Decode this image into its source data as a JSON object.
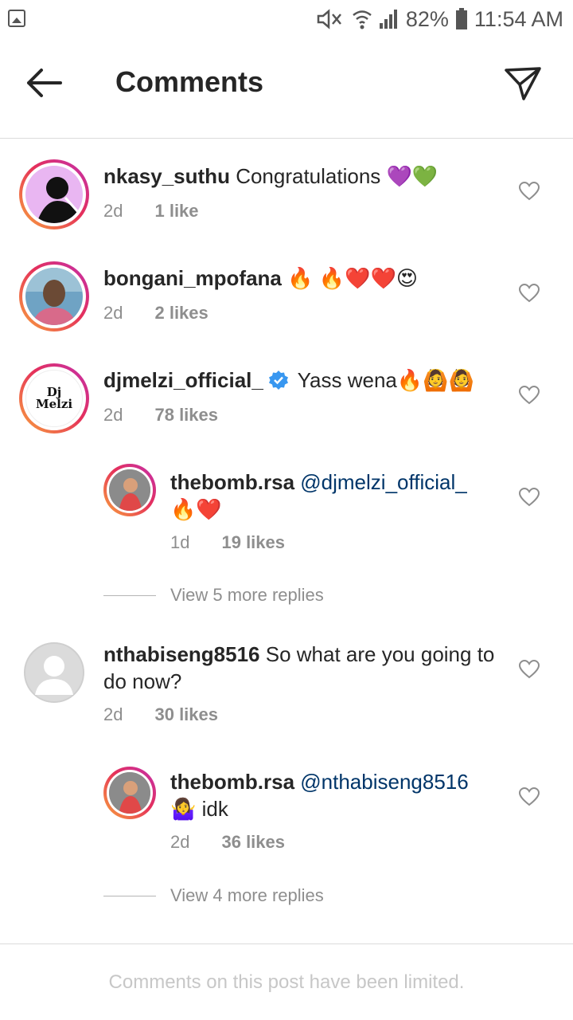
{
  "status_bar": {
    "battery": "82%",
    "time": "11:54 AM"
  },
  "header": {
    "title": "Comments"
  },
  "comments": [
    {
      "username": "nkasy_suthu",
      "text": "Congratulations 💜💚",
      "time": "2d",
      "likes": "1 like"
    },
    {
      "username": "bongani_mpofana",
      "text": "🔥 🔥❤️❤️😍",
      "time": "2d",
      "likes": "2 likes"
    },
    {
      "username": "djmelzi_official_",
      "text": "Yass wena🔥🙆🙆",
      "time": "2d",
      "likes": "78 likes",
      "avatar_text": "Dj Melzi",
      "reply": {
        "username": "thebomb.rsa",
        "mention": "@djmelzi_official_",
        "text": "🔥❤️",
        "time": "1d",
        "likes": "19 likes"
      },
      "view_more": "View 5 more replies"
    },
    {
      "username": "nthabiseng8516",
      "text": "So what are you going to do now?",
      "time": "2d",
      "likes": "30 likes",
      "reply": {
        "username": "thebomb.rsa",
        "mention": "@nthabiseng8516",
        "text": "🤷‍♀️ idk",
        "time": "2d",
        "likes": "36 likes"
      },
      "view_more": "View 4 more replies"
    }
  ],
  "footer": {
    "message": "Comments on this post have been limited."
  },
  "colors": {
    "mention": "#003569",
    "meta": "#8e8e8e",
    "verified": "#3897f0"
  }
}
